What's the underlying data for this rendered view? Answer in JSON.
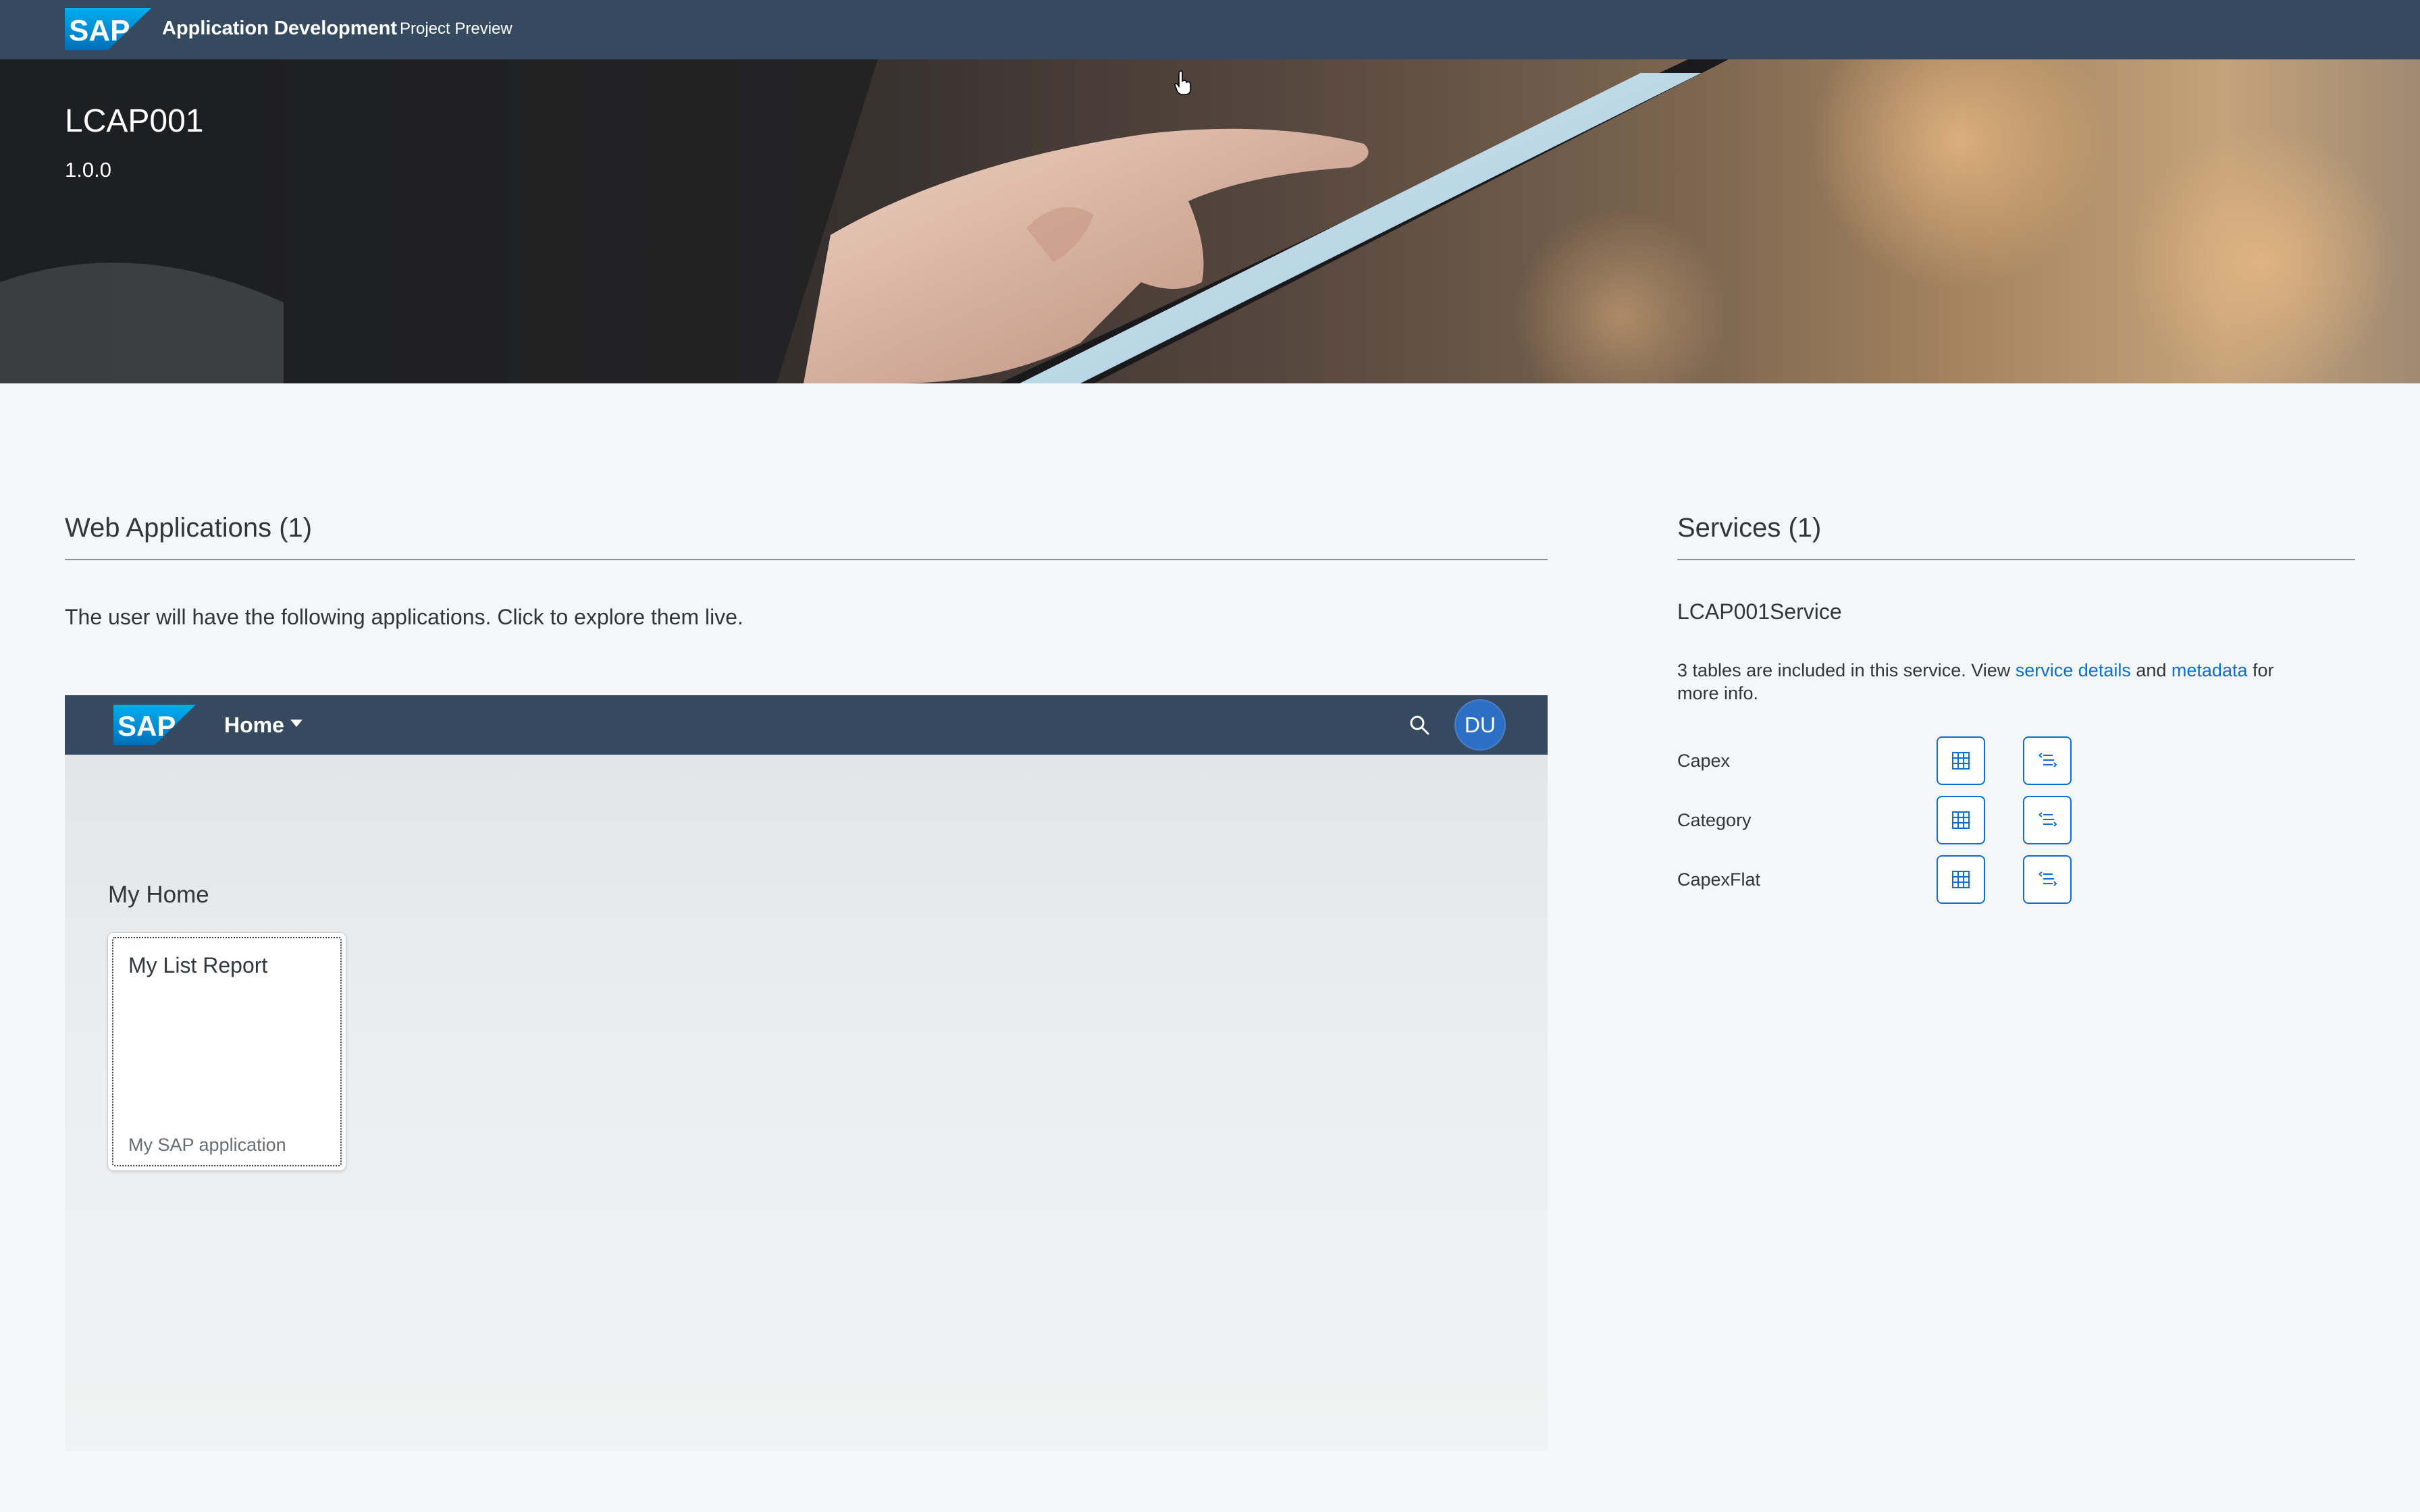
{
  "shell": {
    "logo_text": "SAP",
    "title": "Application Development",
    "subtitle": "Project Preview"
  },
  "hero": {
    "project_name": "LCAP001",
    "version": "1.0.0"
  },
  "web_applications": {
    "header": "Web Applications (1)",
    "description": "The user will have the following applications. Click to explore them live.",
    "launchpad": {
      "logo_text": "SAP",
      "home_label": "Home",
      "avatar_initials": "DU",
      "section_title": "My Home",
      "tiles": [
        {
          "title": "My List Report",
          "subtitle": "My SAP application"
        }
      ]
    }
  },
  "services": {
    "header": "Services (1)",
    "service_name": "LCAP001Service",
    "desc_prefix": "3 tables are included in this service. View ",
    "link_details": "service details",
    "desc_and": " and ",
    "link_metadata": "metadata",
    "desc_suffix": " for more info.",
    "entities": [
      {
        "name": "Capex"
      },
      {
        "name": "Category"
      },
      {
        "name": "CapexFlat"
      }
    ]
  },
  "colors": {
    "shell": "#354a5f",
    "link": "#0a6ed1",
    "avatar": "#2c6fc4"
  }
}
